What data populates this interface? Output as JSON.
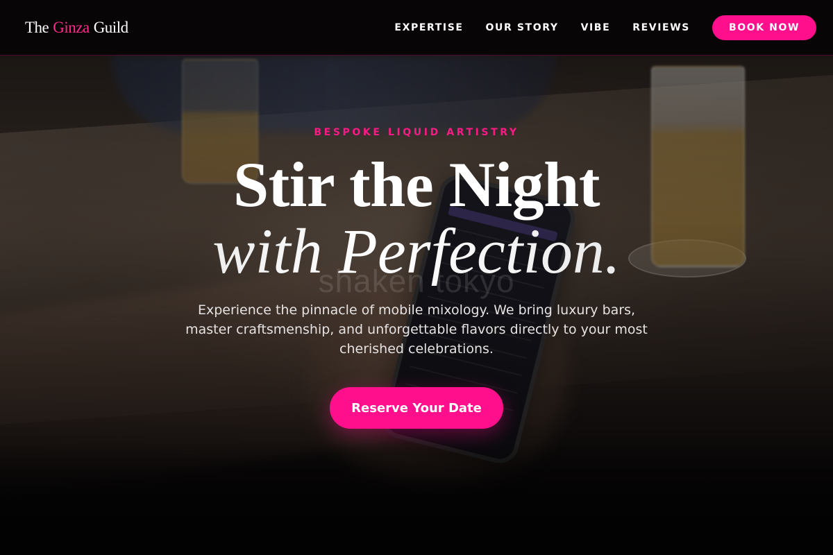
{
  "brand": {
    "part1": "The",
    "part2": "Ginza",
    "part3": "Guild",
    "accent_color": "#ff0f8b"
  },
  "nav": {
    "items": [
      {
        "label": "EXPERTISE"
      },
      {
        "label": "OUR STORY"
      },
      {
        "label": "VIBE"
      },
      {
        "label": "REVIEWS"
      }
    ],
    "cta_label": "BOOK NOW"
  },
  "hero": {
    "eyebrow": "BESPOKE LIQUID ARTISTRY",
    "title_line1": "Stir the Night",
    "title_line2": "with Perfection.",
    "subtitle": "Experience the pinnacle of mobile mixology. We bring luxury bars, master craftsmenship, and unforgettable flavors directly to your most cherished celebrations.",
    "cta_label": "Reserve Your Date",
    "watermark": "shaken tokyo"
  }
}
